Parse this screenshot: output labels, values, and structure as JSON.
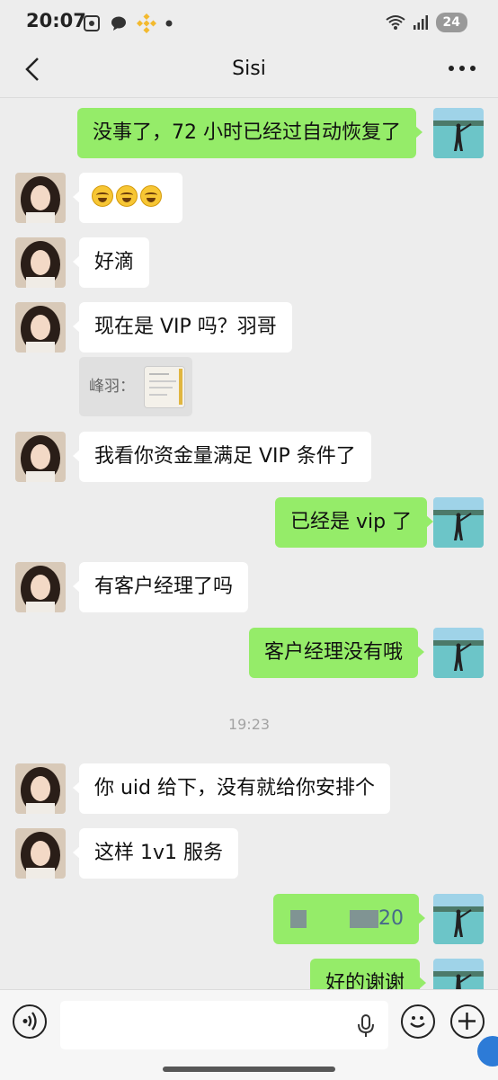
{
  "status_bar": {
    "time": "20:07",
    "battery": "24"
  },
  "chat": {
    "title": "Sisi"
  },
  "messages": {
    "m1": "没事了，72 小时已经过自动恢复了",
    "m2_emoji": [
      "crying-laughing-emoji",
      "crying-laughing-emoji",
      "crying-laughing-emoji"
    ],
    "m3": "好滴",
    "m4": "现在是 VIP 吗？羽哥",
    "quote_label": "峰羽：",
    "m5": "我看你资金量满足 VIP 条件了",
    "m6": "已经是 vip 了",
    "m7": "有客户经理了吗",
    "m8": "客户经理没有哦",
    "timestamp": "19:23",
    "m9": "你 uid 给下，没有就给你安排个",
    "m10": "这样 1v1 服务",
    "m11_visible": "20",
    "m12": "好的谢谢"
  },
  "colors": {
    "background": "#ededed",
    "outgoing_bubble": "#95ec69",
    "incoming_bubble": "#ffffff"
  }
}
